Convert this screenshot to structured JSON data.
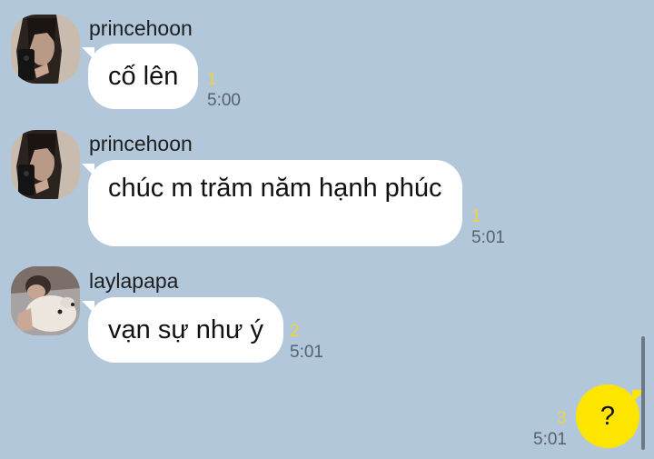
{
  "messages": [
    {
      "sender": "princehoon",
      "text": "cố lên",
      "unread": "1",
      "time": "5:00",
      "avatar": "selfie-avatar-icon"
    },
    {
      "sender": "princehoon",
      "text": "chúc m trăm năm hạnh phúc",
      "unread": "1",
      "time": "5:01",
      "avatar": "selfie-avatar-icon"
    },
    {
      "sender": "laylapapa",
      "text": "vạn sự như ý",
      "unread": "2",
      "time": "5:01",
      "avatar": "dog-avatar-icon"
    }
  ],
  "outgoing": {
    "text": "?",
    "unread": "3",
    "time": "5:01"
  },
  "colors": {
    "background": "#b2c7da",
    "incoming_bubble": "#ffffff",
    "outgoing_bubble": "#fee500",
    "unread_count": "#f0d23a"
  }
}
